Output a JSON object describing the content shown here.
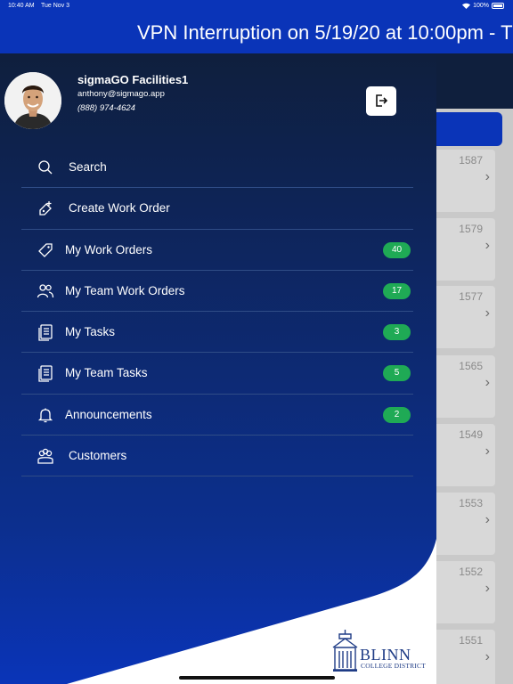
{
  "status_bar": {
    "time": "10:40 AM",
    "date": "Tue Nov 3",
    "battery": "100%"
  },
  "banner": {
    "text": "VPN Interruption on 5/19/20 at 10:00pm - T"
  },
  "user": {
    "name": "sigmaGO Facilities1",
    "email": "anthony@sigmago.app",
    "phone": "(888) 974-4624"
  },
  "menu": {
    "items": [
      {
        "label": "Search",
        "icon": "search-icon"
      },
      {
        "label": "Create Work Order",
        "icon": "create-work-order-icon"
      },
      {
        "label": "My Work Orders",
        "icon": "tag-icon",
        "badge": "40"
      },
      {
        "label": "My Team Work Orders",
        "icon": "team-icon",
        "badge": "17"
      },
      {
        "label": "My Tasks",
        "icon": "tasks-icon",
        "badge": "3"
      },
      {
        "label": "My Team Tasks",
        "icon": "tasks-icon",
        "badge": "5"
      },
      {
        "label": "Announcements",
        "icon": "bell-icon",
        "badge": "2"
      },
      {
        "label": "Customers",
        "icon": "customers-icon"
      }
    ]
  },
  "background_list": {
    "numbers": [
      "1587",
      "1579",
      "1577",
      "1565",
      "1549",
      "1553",
      "1552",
      "1551"
    ]
  },
  "logo": {
    "line1": "BLINN",
    "line2": "COLLEGE DISTRICT"
  },
  "colors": {
    "accent": "#0a34b8",
    "drawer_top": "#0f1f3d",
    "badge": "#1faa55"
  }
}
